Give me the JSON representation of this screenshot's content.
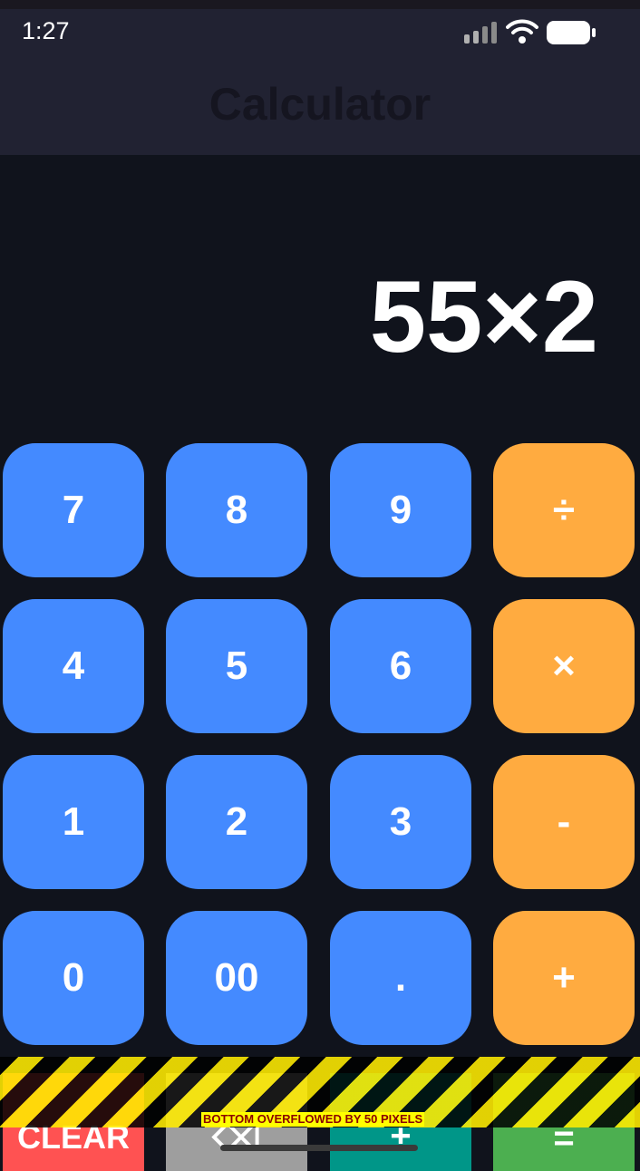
{
  "status_bar": {
    "time": "1:27"
  },
  "app_bar": {
    "title": "Calculator"
  },
  "display": {
    "expression": "55×2"
  },
  "keypad": {
    "row1": [
      "7",
      "8",
      "9",
      "÷"
    ],
    "row2": [
      "4",
      "5",
      "6",
      "×"
    ],
    "row3": [
      "1",
      "2",
      "3",
      "-"
    ],
    "row4": [
      "0",
      "00",
      ".",
      "+"
    ]
  },
  "bottom_row": {
    "clear": "CLEAR",
    "backspace": "⌫",
    "plus_minus": "±",
    "equals": "="
  },
  "debug": {
    "overflow_message": "BOTTOM OVERFLOWED BY 50 PIXELS"
  },
  "colors": {
    "digit_key": "#448aff",
    "operator_key": "#ffab40",
    "clear_key": "#ff5252",
    "backspace_key": "#9e9e9e",
    "plus_minus_key": "#009688",
    "equals_key": "#4caf50",
    "background": "#10131c",
    "app_bar": "#212232"
  }
}
